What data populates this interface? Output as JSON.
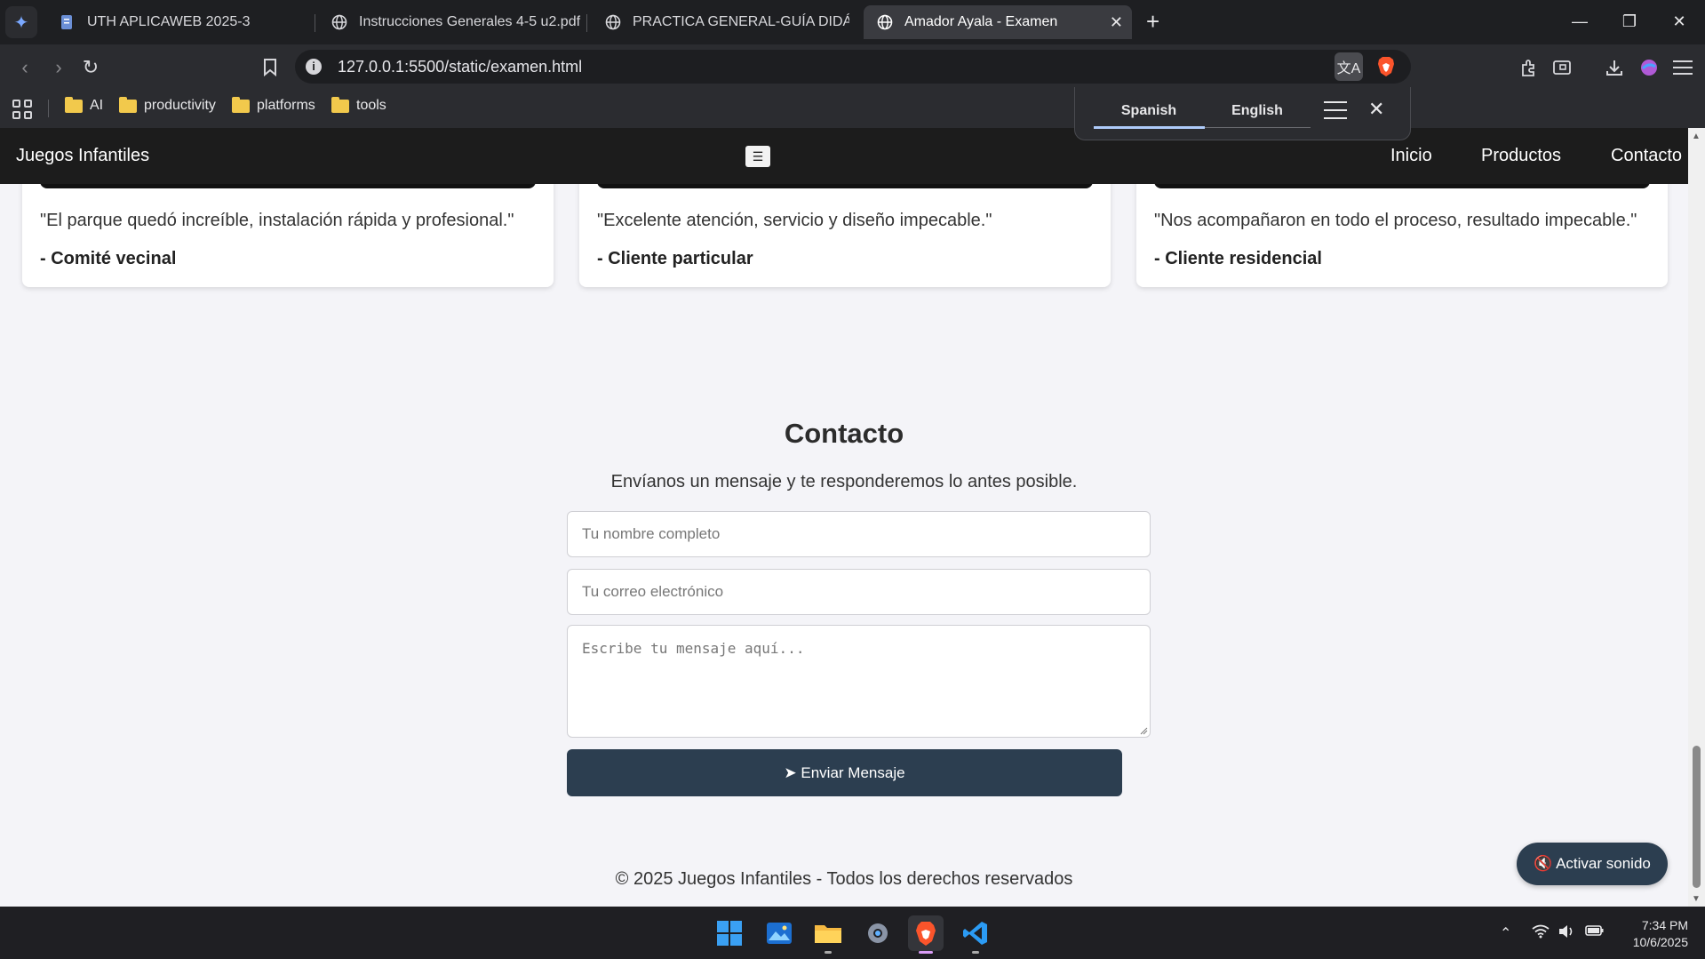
{
  "browser": {
    "tabs": [
      {
        "title": "UTH APLICAWEB 2025-3",
        "icon": "document-icon"
      },
      {
        "title": "Instrucciones Generales 4-5 u2.pdf",
        "icon": "globe-icon"
      },
      {
        "title": "PRACTICA GENERAL-GUÍA DIDÁCTIC",
        "icon": "globe-icon"
      },
      {
        "title": "Amador Ayala - Examen",
        "icon": "globe-icon",
        "active": true
      }
    ],
    "url": "127.0.0.1:5500/static/examen.html",
    "bookmarks": [
      "AI",
      "productivity",
      "platforms",
      "tools"
    ],
    "translate": {
      "source": "Spanish",
      "target": "English"
    }
  },
  "site": {
    "brand": "Juegos Infantiles",
    "menu_toggle": "☰",
    "nav": [
      "Inicio",
      "Productos",
      "Contacto"
    ]
  },
  "testimonials": [
    {
      "quote": "\"El parque quedó increíble, instalación rápida y profesional.\"",
      "author": "- Comité vecinal"
    },
    {
      "quote": "\"Excelente atención, servicio y diseño impecable.\"",
      "author": "- Cliente particular"
    },
    {
      "quote": "\"Nos acompañaron en todo el proceso, resultado impecable.\"",
      "author": "- Cliente residencial"
    }
  ],
  "contact": {
    "title": "Contacto",
    "subtitle": "Envíanos un mensaje y te responderemos lo antes posible.",
    "name_placeholder": "Tu nombre completo",
    "email_placeholder": "Tu correo electrónico",
    "message_placeholder": "Escribe tu mensaje aquí...",
    "send_label": "➤ Enviar Mensaje"
  },
  "footer": "© 2025 Juegos Infantiles - Todos los derechos reservados",
  "sound_button": "🔇 Activar sonido",
  "taskbar": {
    "time": "7:34 PM",
    "date": "10/6/2025"
  },
  "colors": {
    "nav_bg": "#1c1c1c",
    "button_bg": "#2c3e50",
    "page_bg": "#f4f4f8"
  }
}
